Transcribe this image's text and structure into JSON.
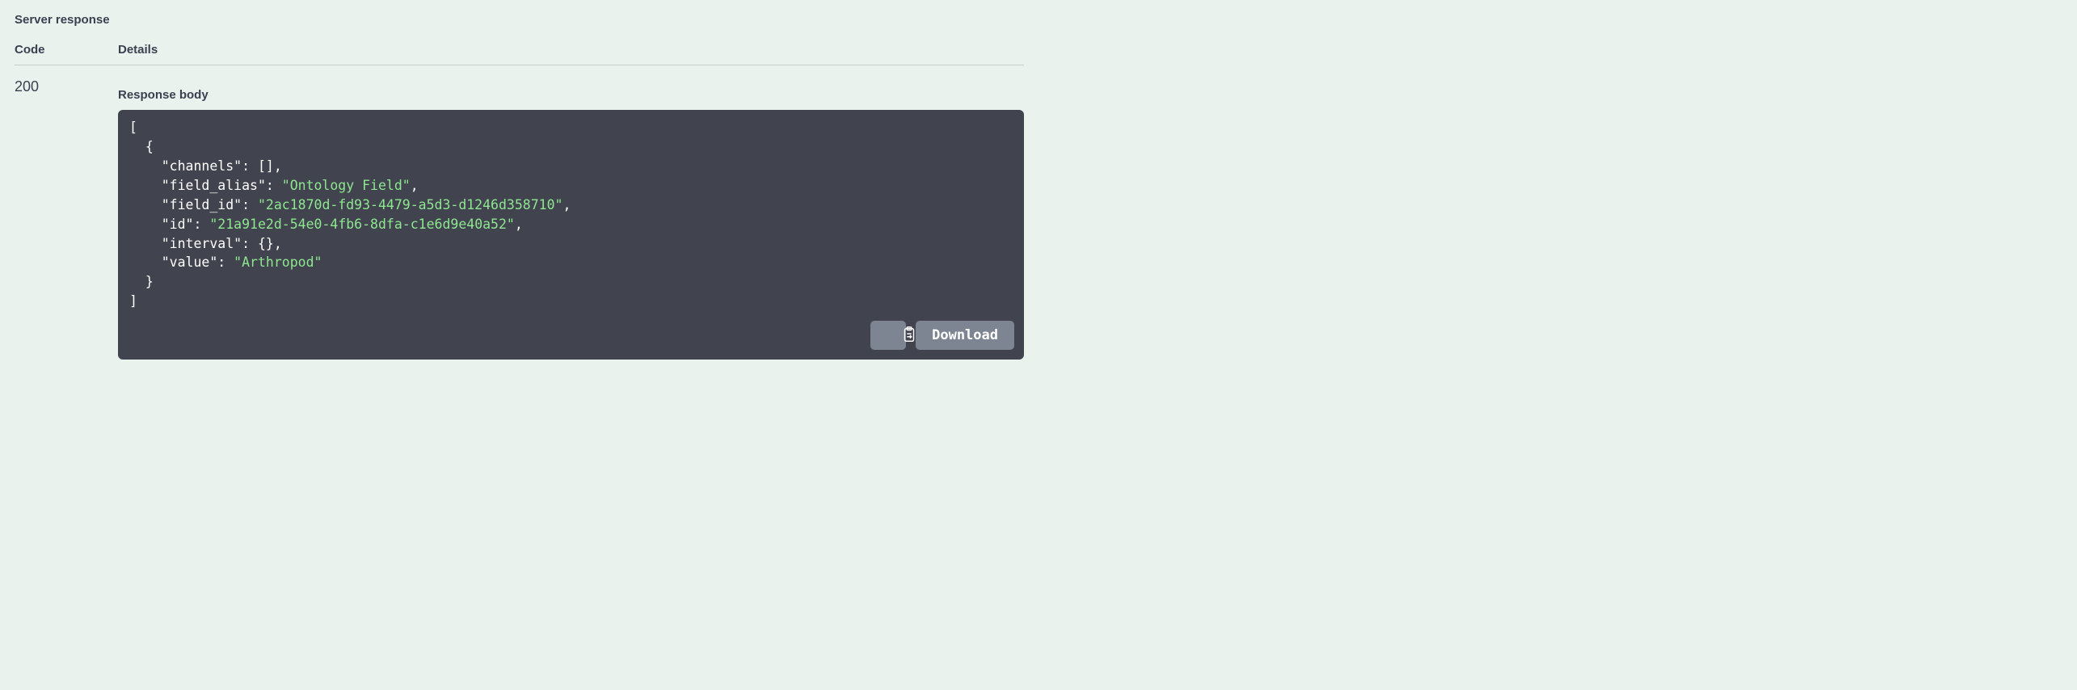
{
  "section_title": "Server response",
  "columns": {
    "code": "Code",
    "details": "Details"
  },
  "status_code": "200",
  "response_body_label": "Response body",
  "json": {
    "keys": {
      "channels": "\"channels\"",
      "field_alias": "\"field_alias\"",
      "field_id": "\"field_id\"",
      "id": "\"id\"",
      "interval": "\"interval\"",
      "value": "\"value\""
    },
    "values": {
      "channels": "[]",
      "field_alias": "\"Ontology Field\"",
      "field_id": "\"2ac1870d-fd93-4479-a5d3-d1246d358710\"",
      "id": "\"21a91e2d-54e0-4fb6-8dfa-c1e6d9e40a52\"",
      "interval": "{}",
      "value_str": "\"Arthropod\""
    }
  },
  "buttons": {
    "download": "Download"
  }
}
